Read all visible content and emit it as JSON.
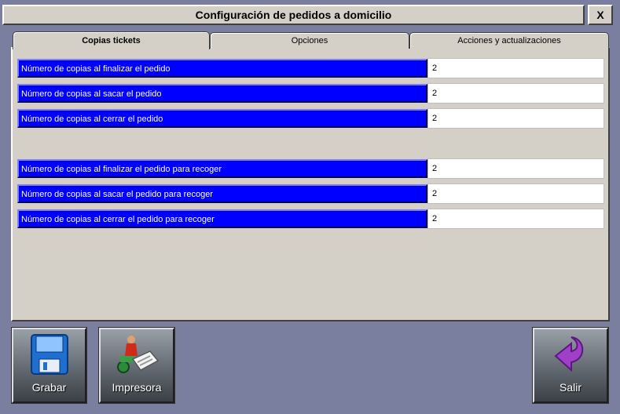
{
  "window": {
    "title": "Configuración de pedidos a domicilio",
    "close_label": "X"
  },
  "tabs": [
    {
      "label": "Copias tickets",
      "active": true
    },
    {
      "label": "Opciones",
      "active": false
    },
    {
      "label": "Acciones y actualizaciones",
      "active": false
    }
  ],
  "fields": [
    {
      "label": "Número de copias al finalizar el pedido",
      "value": "2"
    },
    {
      "label": "Número de copias al sacar el pedido",
      "value": "2"
    },
    {
      "label": "Número de copias al cerrar el pedido",
      "value": "2"
    },
    {
      "label": "Número de copias al finalizar el pedido para recoger",
      "value": "2"
    },
    {
      "label": "Número de copias al sacar el pedido para recoger",
      "value": "2"
    },
    {
      "label": "Número de copias al cerrar el pedido para recoger",
      "value": "2"
    }
  ],
  "buttons": {
    "grabar": {
      "label": "Grabar",
      "icon": "floppy-disk-icon"
    },
    "impresora": {
      "label": "Impresora",
      "icon": "printer-delivery-icon"
    },
    "salir": {
      "label": "Salir",
      "icon": "return-arrow-icon"
    }
  },
  "colors": {
    "background": "#7b7f9f",
    "label_blue": "#0000ff",
    "panel": "#d4d0c8"
  }
}
